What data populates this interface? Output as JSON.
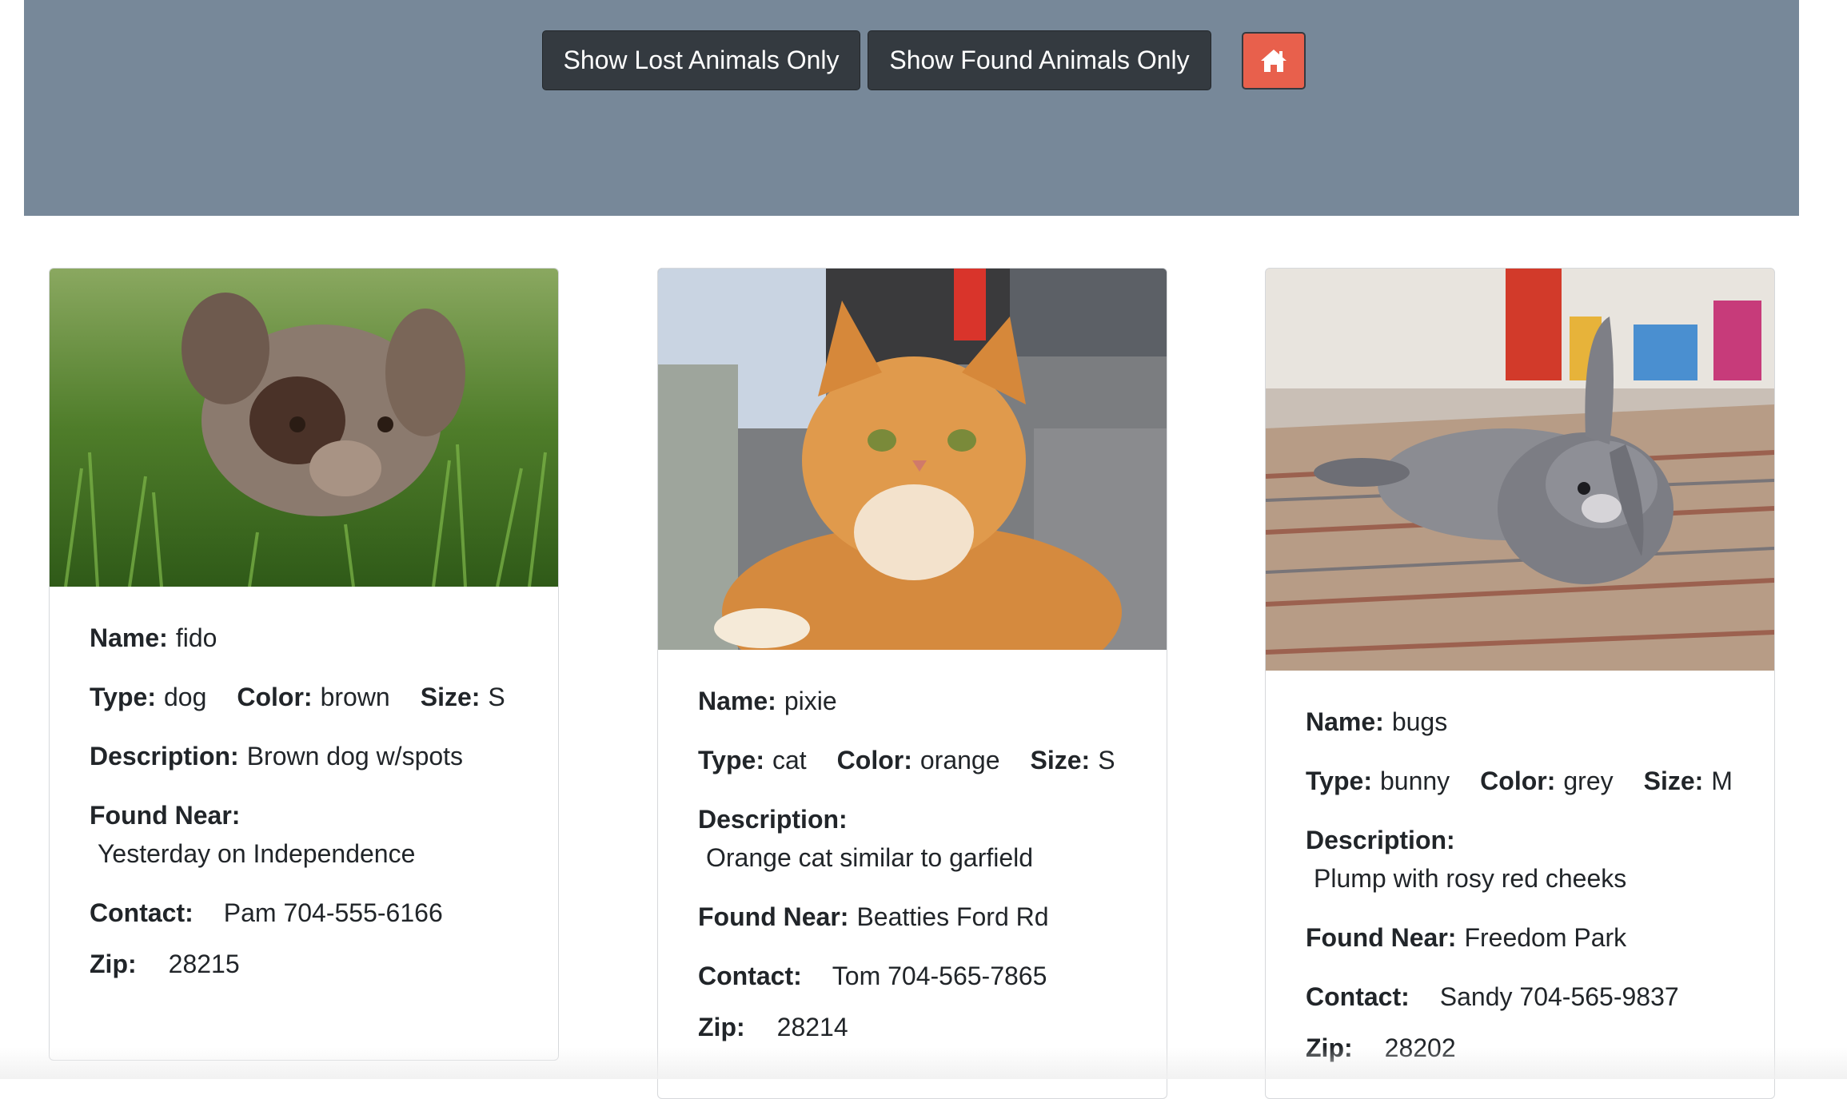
{
  "toolbar": {
    "lost_label": "Show Lost Animals Only",
    "found_label": "Show Found Animals Only",
    "home_icon": "home-icon"
  },
  "colors": {
    "header_bg": "#778899",
    "button_dark": "#343a40",
    "home_button": "#e8604c"
  },
  "labels": {
    "name": "Name:",
    "type": "Type:",
    "color": "Color:",
    "size": "Size:",
    "description": "Description:",
    "found_near": "Found Near:",
    "contact": "Contact:",
    "zip": "Zip:"
  },
  "animals": [
    {
      "name": "fido",
      "type": "dog",
      "color": "brown",
      "size": "S",
      "description": "Brown dog w/spots",
      "found_near": "Yesterday on Independence",
      "contact": "Pam 704-555-6166",
      "zip": "28215"
    },
    {
      "name": "pixie",
      "type": "cat",
      "color": "orange",
      "size": "S",
      "description": "Orange cat similar to garfield",
      "found_near": "Beatties Ford Rd",
      "contact": "Tom 704-565-7865",
      "zip": "28214"
    },
    {
      "name": "bugs",
      "type": "bunny",
      "color": "grey",
      "size": "M",
      "description": "Plump with rosy red cheeks",
      "found_near": "Freedom Park",
      "contact": "Sandy 704-565-9837",
      "zip": "28202"
    }
  ]
}
